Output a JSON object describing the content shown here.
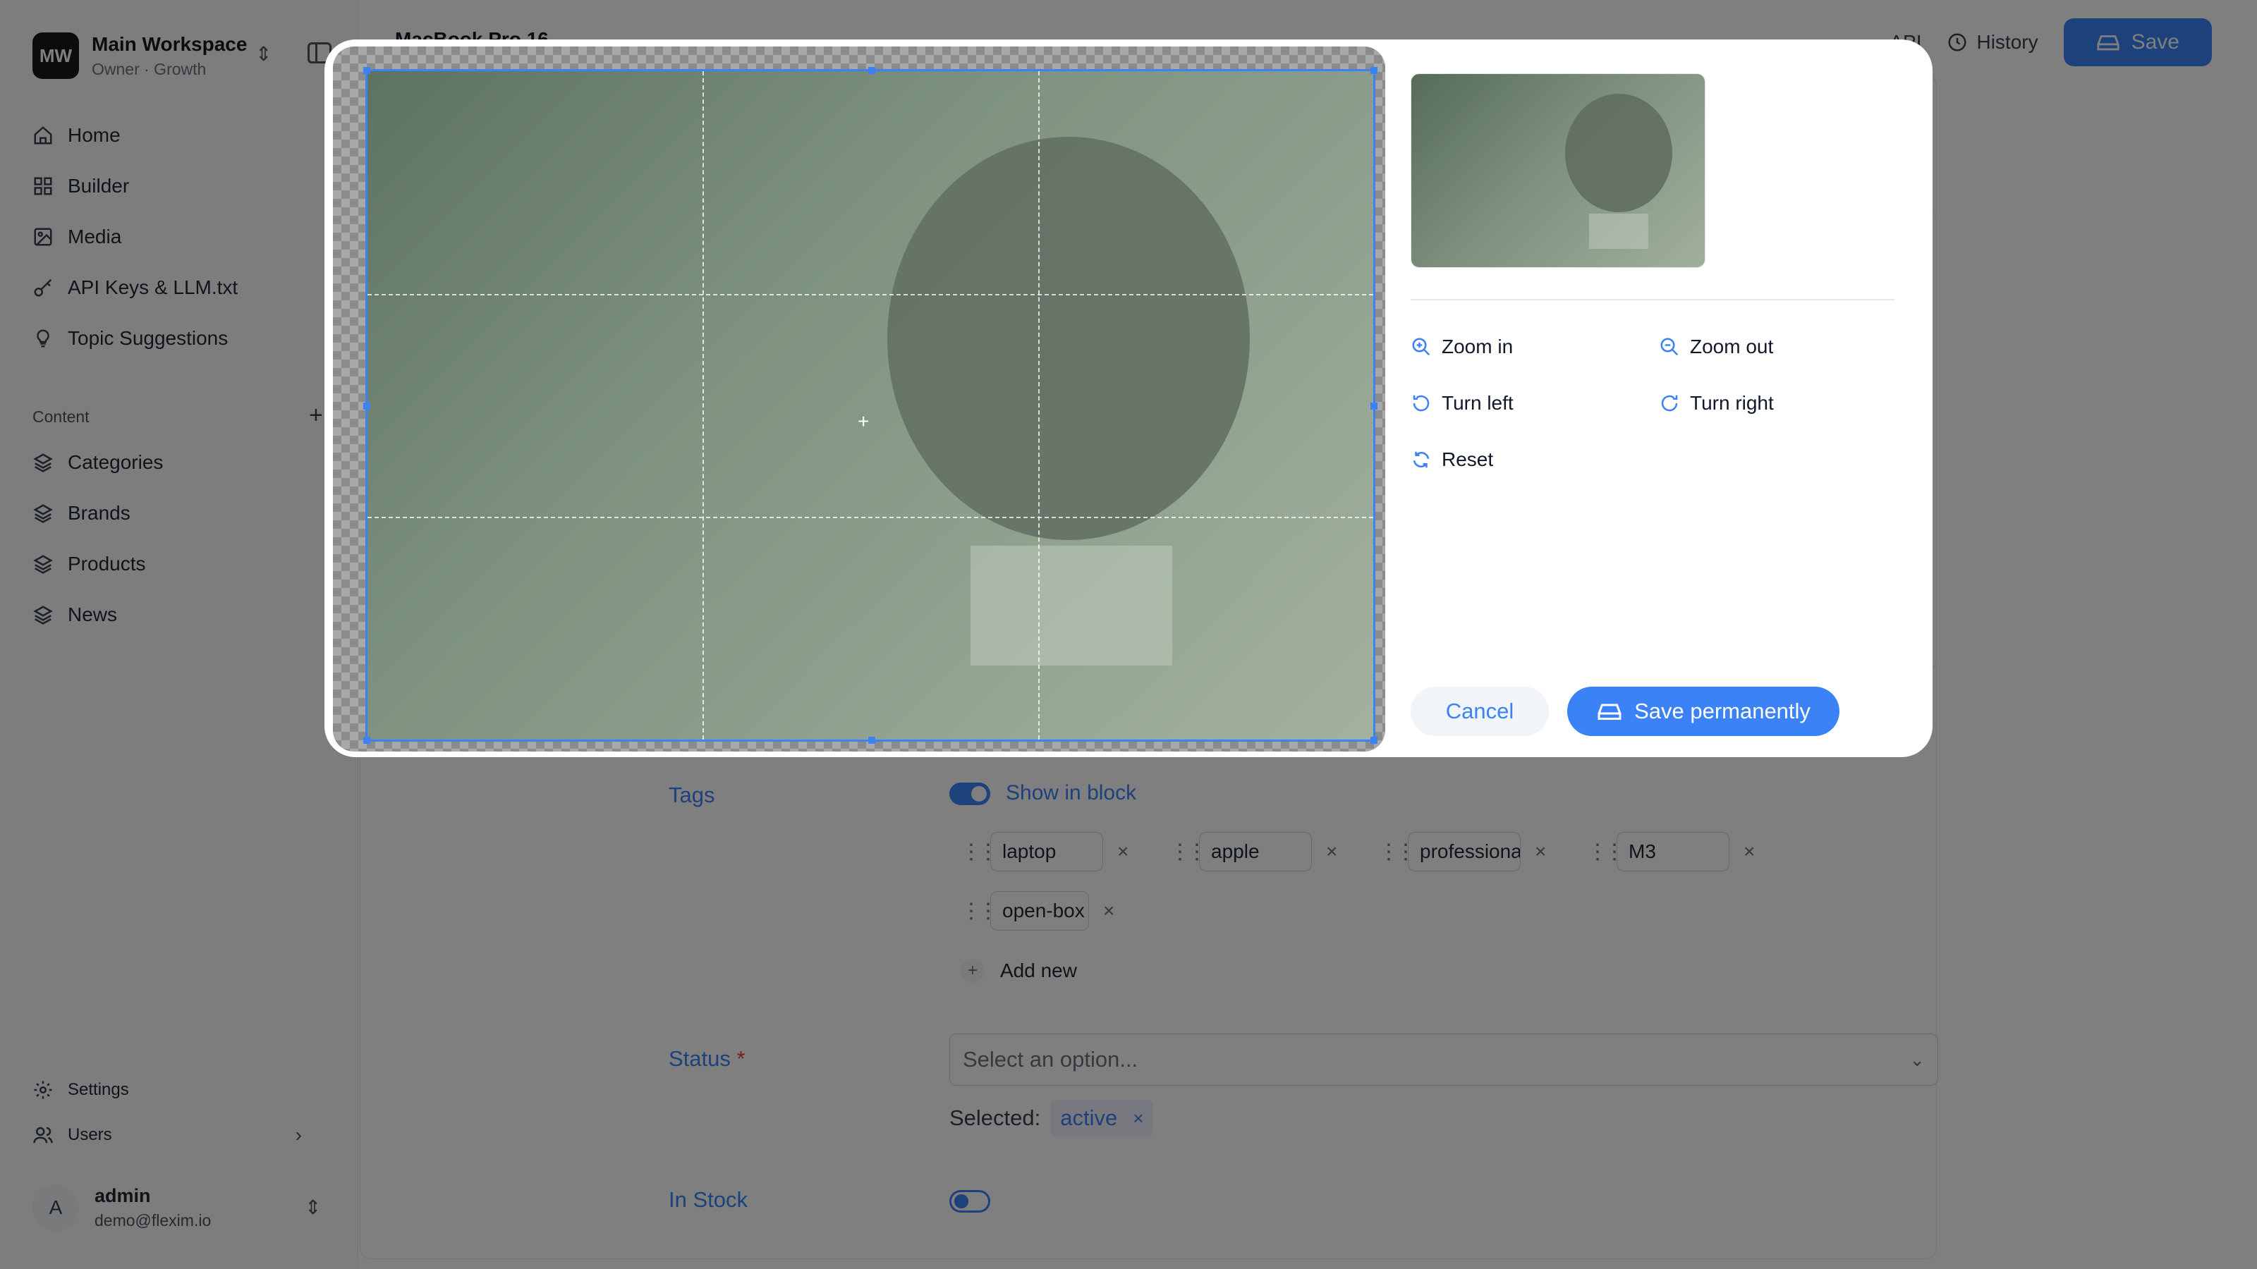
{
  "workspace": {
    "initials": "MW",
    "name": "Main Workspace",
    "role": "Owner · Growth"
  },
  "nav": {
    "main": [
      {
        "label": "Home",
        "icon": "home-icon"
      },
      {
        "label": "Builder",
        "icon": "grid-icon"
      },
      {
        "label": "Media",
        "icon": "image-icon"
      },
      {
        "label": "API Keys & LLM.txt",
        "icon": "key-icon"
      },
      {
        "label": "Topic Suggestions",
        "icon": "lightbulb-icon"
      }
    ],
    "content_section": "Content",
    "content": [
      {
        "label": "Categories",
        "icon": "layers-icon"
      },
      {
        "label": "Brands",
        "icon": "layers-icon"
      },
      {
        "label": "Products",
        "icon": "layers-icon"
      },
      {
        "label": "News",
        "icon": "layers-icon"
      }
    ],
    "settings": "Settings",
    "users": "Users"
  },
  "user": {
    "initial": "A",
    "name": "admin",
    "email": "demo@flexim.io"
  },
  "topbar": {
    "api": "API",
    "history": "History",
    "save": "Save",
    "doc_title": "MacBook Pro 16"
  },
  "form": {
    "tags_label": "Tags",
    "show_in_block": "Show in block",
    "tags": [
      "laptop",
      "apple",
      "professional",
      "M3",
      "open-box"
    ],
    "add_new": "Add new",
    "status_label": "Status",
    "status_placeholder": "Select an option...",
    "selected_label": "Selected:",
    "selected_value": "active",
    "in_stock_label": "In Stock"
  },
  "modal": {
    "tools": {
      "zoom_in": "Zoom in",
      "zoom_out": "Zoom out",
      "turn_left": "Turn left",
      "turn_right": "Turn right",
      "reset": "Reset"
    },
    "cancel": "Cancel",
    "save_permanently": "Save permanently"
  },
  "colors": {
    "accent": "#3b82f6",
    "overlay": "rgba(0,0,0,0.5)"
  }
}
